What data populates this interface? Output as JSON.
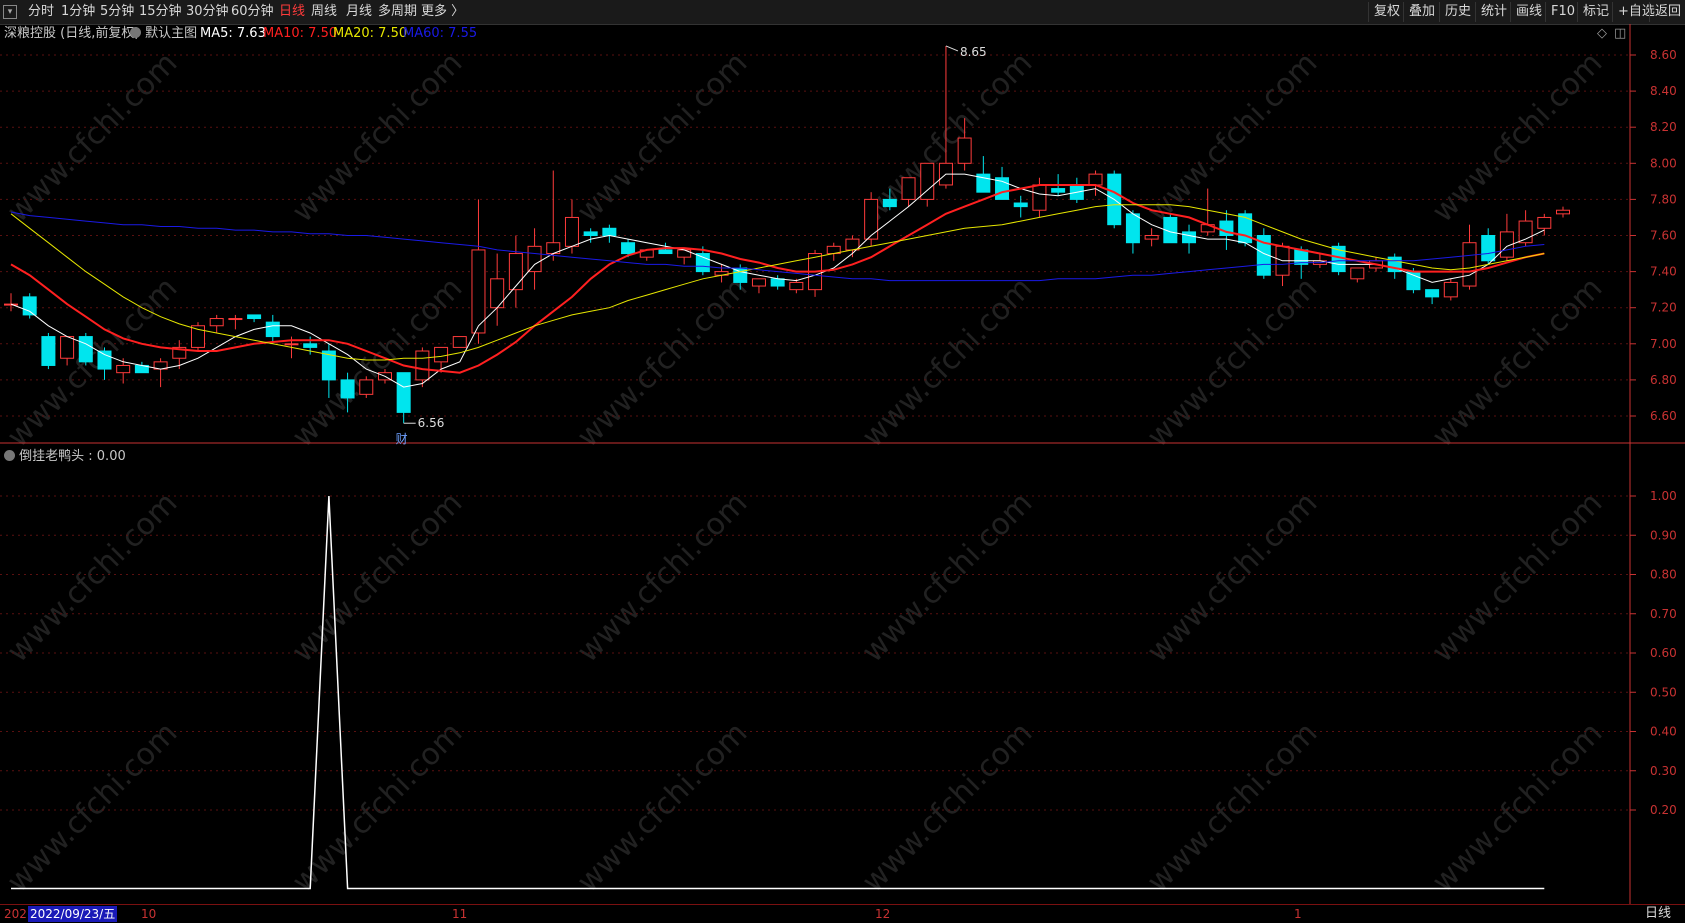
{
  "toolbar": {
    "periods": [
      "分时",
      "1分钟",
      "5分钟",
      "15分钟",
      "30分钟",
      "60分钟",
      "日线",
      "周线",
      "月线",
      "多周期",
      "更多 〉"
    ],
    "active_period": "日线",
    "right_buttons": [
      "复权",
      "叠加",
      "历史",
      "统计",
      "画线",
      "F10",
      "标记",
      "+自选",
      "返回"
    ]
  },
  "main_info": {
    "stock": "深粮控股 (日线,前复权)",
    "template": "默认主图",
    "ma5": "MA5: 7.63",
    "ma10": "MA10: 7.50",
    "ma20": "MA20: 7.50",
    "ma60": "MA60: 7.55"
  },
  "indicator_info": {
    "label": "倒挂老鸭头 : 0.00"
  },
  "annotations": {
    "high": "8.65",
    "low": "6.56",
    "marker": "财"
  },
  "bottom": {
    "prefix": "202",
    "date": "2022/09/23/五",
    "months": [
      "10",
      "11",
      "12",
      "1"
    ],
    "period": "日线"
  },
  "watermark": "www.cfchi.com",
  "colors": {
    "up": "#ff3b3b",
    "down": "#00e5ee",
    "ma5": "#ffffff",
    "ma10": "#ff2020",
    "ma20": "#e6e600",
    "ma60": "#1a1ae6",
    "axis": "#c83232",
    "indicator": "#ffffff"
  },
  "chart_data": [
    {
      "type": "candlestick",
      "title": "深粮控股 (日线,前复权)",
      "y_ticks": [
        "8.60",
        "8.40",
        "8.20",
        "8.00",
        "7.80",
        "7.60",
        "7.40",
        "7.20",
        "7.00",
        "6.80",
        "6.60"
      ],
      "ylim": [
        6.52,
        8.72
      ],
      "ohlc": [
        [
          7.22,
          7.28,
          7.18,
          7.22
        ],
        [
          7.26,
          7.28,
          7.14,
          7.16
        ],
        [
          7.04,
          7.06,
          6.86,
          6.88
        ],
        [
          6.92,
          7.04,
          6.88,
          7.04
        ],
        [
          7.04,
          7.06,
          6.88,
          6.9
        ],
        [
          6.96,
          6.98,
          6.8,
          6.86
        ],
        [
          6.84,
          6.92,
          6.78,
          6.88
        ],
        [
          6.88,
          6.9,
          6.84,
          6.84
        ],
        [
          6.86,
          6.92,
          6.76,
          6.9
        ],
        [
          6.92,
          7.02,
          6.86,
          6.98
        ],
        [
          6.98,
          7.12,
          6.96,
          7.1
        ],
        [
          7.1,
          7.16,
          7.06,
          7.14
        ],
        [
          7.14,
          7.16,
          7.08,
          7.14
        ],
        [
          7.16,
          7.16,
          7.12,
          7.14
        ],
        [
          7.12,
          7.16,
          7.0,
          7.04
        ],
        [
          7.0,
          7.04,
          6.92,
          7.0
        ],
        [
          7.0,
          7.04,
          6.94,
          6.98
        ],
        [
          6.96,
          7.0,
          6.7,
          6.8
        ],
        [
          6.8,
          6.84,
          6.62,
          6.7
        ],
        [
          6.72,
          6.82,
          6.7,
          6.8
        ],
        [
          6.8,
          6.86,
          6.78,
          6.84
        ],
        [
          6.84,
          6.84,
          6.56,
          6.62
        ],
        [
          6.8,
          6.98,
          6.76,
          6.96
        ],
        [
          6.9,
          6.98,
          6.84,
          6.98
        ],
        [
          6.98,
          7.04,
          6.98,
          7.04
        ],
        [
          7.06,
          7.8,
          7.0,
          7.52
        ],
        [
          7.2,
          7.5,
          7.1,
          7.36
        ],
        [
          7.3,
          7.6,
          7.2,
          7.5
        ],
        [
          7.4,
          7.64,
          7.3,
          7.54
        ],
        [
          7.5,
          7.96,
          7.46,
          7.56
        ],
        [
          7.54,
          7.8,
          7.5,
          7.7
        ],
        [
          7.62,
          7.64,
          7.56,
          7.6
        ],
        [
          7.64,
          7.66,
          7.56,
          7.6
        ],
        [
          7.56,
          7.58,
          7.48,
          7.5
        ],
        [
          7.48,
          7.52,
          7.46,
          7.52
        ],
        [
          7.52,
          7.56,
          7.5,
          7.5
        ],
        [
          7.48,
          7.52,
          7.44,
          7.52
        ],
        [
          7.5,
          7.54,
          7.38,
          7.4
        ],
        [
          7.38,
          7.44,
          7.34,
          7.4
        ],
        [
          7.42,
          7.44,
          7.3,
          7.34
        ],
        [
          7.32,
          7.36,
          7.28,
          7.36
        ],
        [
          7.36,
          7.38,
          7.3,
          7.32
        ],
        [
          7.3,
          7.36,
          7.28,
          7.34
        ],
        [
          7.3,
          7.52,
          7.26,
          7.5
        ],
        [
          7.5,
          7.56,
          7.46,
          7.54
        ],
        [
          7.52,
          7.6,
          7.48,
          7.58
        ],
        [
          7.58,
          7.84,
          7.54,
          7.8
        ],
        [
          7.8,
          7.86,
          7.74,
          7.76
        ],
        [
          7.8,
          7.92,
          7.76,
          7.92
        ],
        [
          7.8,
          8.0,
          7.76,
          8.0
        ],
        [
          7.88,
          8.65,
          7.86,
          8.0
        ],
        [
          8.0,
          8.25,
          7.96,
          8.14
        ],
        [
          7.94,
          8.04,
          7.84,
          7.84
        ],
        [
          7.92,
          7.98,
          7.8,
          7.8
        ],
        [
          7.78,
          7.82,
          7.7,
          7.76
        ],
        [
          7.74,
          7.92,
          7.7,
          7.88
        ],
        [
          7.86,
          7.94,
          7.82,
          7.84
        ],
        [
          7.88,
          7.92,
          7.78,
          7.8
        ],
        [
          7.88,
          7.96,
          7.82,
          7.94
        ],
        [
          7.94,
          7.96,
          7.64,
          7.66
        ],
        [
          7.72,
          7.74,
          7.5,
          7.56
        ],
        [
          7.58,
          7.64,
          7.54,
          7.6
        ],
        [
          7.7,
          7.72,
          7.56,
          7.56
        ],
        [
          7.62,
          7.66,
          7.5,
          7.56
        ],
        [
          7.62,
          7.86,
          7.6,
          7.66
        ],
        [
          7.68,
          7.74,
          7.52,
          7.6
        ],
        [
          7.72,
          7.74,
          7.54,
          7.56
        ],
        [
          7.6,
          7.64,
          7.36,
          7.38
        ],
        [
          7.38,
          7.56,
          7.32,
          7.54
        ],
        [
          7.52,
          7.54,
          7.36,
          7.44
        ],
        [
          7.44,
          7.5,
          7.42,
          7.46
        ],
        [
          7.54,
          7.56,
          7.38,
          7.4
        ],
        [
          7.36,
          7.42,
          7.34,
          7.42
        ],
        [
          7.42,
          7.48,
          7.4,
          7.46
        ],
        [
          7.48,
          7.5,
          7.36,
          7.4
        ],
        [
          7.4,
          7.42,
          7.28,
          7.3
        ],
        [
          7.3,
          7.3,
          7.22,
          7.26
        ],
        [
          7.26,
          7.36,
          7.24,
          7.34
        ],
        [
          7.32,
          7.66,
          7.3,
          7.56
        ],
        [
          7.6,
          7.64,
          7.44,
          7.46
        ],
        [
          7.48,
          7.72,
          7.46,
          7.62
        ],
        [
          7.56,
          7.74,
          7.54,
          7.68
        ],
        [
          7.64,
          7.72,
          7.6,
          7.7
        ],
        [
          7.72,
          7.76,
          7.7,
          7.74
        ]
      ],
      "series": [
        {
          "name": "MA5",
          "values": [
            7.22,
            7.18,
            7.1,
            7.04,
            7.0,
            6.94,
            6.9,
            6.88,
            6.86,
            6.88,
            6.92,
            6.98,
            7.04,
            7.08,
            7.1,
            7.1,
            7.06,
            7.0,
            6.94,
            6.86,
            6.82,
            6.76,
            6.78,
            6.86,
            6.9,
            7.1,
            7.2,
            7.32,
            7.44,
            7.5,
            7.54,
            7.58,
            7.6,
            7.58,
            7.56,
            7.54,
            7.52,
            7.48,
            7.44,
            7.4,
            7.38,
            7.36,
            7.35,
            7.38,
            7.42,
            7.5,
            7.6,
            7.68,
            7.76,
            7.85,
            7.94,
            7.94,
            7.92,
            7.9,
            7.86,
            7.83,
            7.82,
            7.84,
            7.86,
            7.8,
            7.72,
            7.66,
            7.62,
            7.6,
            7.58,
            7.58,
            7.56,
            7.5,
            7.46,
            7.46,
            7.46,
            7.44,
            7.44,
            7.44,
            7.42,
            7.38,
            7.34,
            7.36,
            7.38,
            7.44,
            7.54,
            7.58,
            7.63
          ]
        },
        {
          "name": "MA10",
          "values": [
            7.44,
            7.38,
            7.3,
            7.22,
            7.15,
            7.08,
            7.03,
            7.0,
            6.98,
            6.97,
            6.96,
            6.96,
            6.98,
            7.0,
            7.01,
            7.02,
            7.02,
            7.02,
            7.0,
            6.96,
            6.92,
            6.88,
            6.86,
            6.85,
            6.84,
            6.88,
            6.94,
            7.01,
            7.1,
            7.18,
            7.26,
            7.36,
            7.44,
            7.49,
            7.52,
            7.53,
            7.53,
            7.52,
            7.5,
            7.47,
            7.45,
            7.42,
            7.4,
            7.4,
            7.41,
            7.44,
            7.48,
            7.54,
            7.6,
            7.66,
            7.72,
            7.76,
            7.8,
            7.84,
            7.86,
            7.88,
            7.88,
            7.88,
            7.88,
            7.84,
            7.78,
            7.74,
            7.72,
            7.7,
            7.66,
            7.62,
            7.6,
            7.56,
            7.54,
            7.52,
            7.5,
            7.48,
            7.46,
            7.44,
            7.42,
            7.4,
            7.4,
            7.4,
            7.4,
            7.42,
            7.45,
            7.48,
            7.5
          ]
        },
        {
          "name": "MA20",
          "values": [
            7.72,
            7.64,
            7.56,
            7.48,
            7.4,
            7.33,
            7.26,
            7.2,
            7.15,
            7.11,
            7.08,
            7.06,
            7.04,
            7.02,
            7.0,
            6.98,
            6.96,
            6.94,
            6.92,
            6.91,
            6.91,
            6.92,
            6.92,
            6.93,
            6.95,
            6.98,
            7.02,
            7.06,
            7.1,
            7.13,
            7.16,
            7.18,
            7.2,
            7.24,
            7.27,
            7.3,
            7.33,
            7.36,
            7.38,
            7.4,
            7.42,
            7.44,
            7.46,
            7.48,
            7.5,
            7.52,
            7.54,
            7.56,
            7.58,
            7.6,
            7.62,
            7.64,
            7.65,
            7.66,
            7.68,
            7.7,
            7.72,
            7.74,
            7.76,
            7.77,
            7.77,
            7.77,
            7.77,
            7.76,
            7.74,
            7.72,
            7.7,
            7.66,
            7.62,
            7.58,
            7.55,
            7.52,
            7.5,
            7.48,
            7.46,
            7.44,
            7.42,
            7.41,
            7.42,
            7.44,
            7.46,
            7.48,
            7.5
          ]
        },
        {
          "name": "MA60",
          "values": [
            7.73,
            7.71,
            7.7,
            7.69,
            7.68,
            7.67,
            7.66,
            7.66,
            7.65,
            7.65,
            7.64,
            7.64,
            7.63,
            7.63,
            7.62,
            7.62,
            7.61,
            7.61,
            7.6,
            7.6,
            7.59,
            7.58,
            7.57,
            7.56,
            7.55,
            7.54,
            7.52,
            7.51,
            7.5,
            7.49,
            7.48,
            7.47,
            7.46,
            7.45,
            7.44,
            7.44,
            7.43,
            7.43,
            7.42,
            7.42,
            7.41,
            7.4,
            7.39,
            7.38,
            7.37,
            7.36,
            7.36,
            7.35,
            7.35,
            7.35,
            7.35,
            7.35,
            7.35,
            7.35,
            7.35,
            7.35,
            7.36,
            7.36,
            7.36,
            7.37,
            7.38,
            7.38,
            7.39,
            7.4,
            7.41,
            7.42,
            7.43,
            7.44,
            7.44,
            7.45,
            7.45,
            7.46,
            7.46,
            7.46,
            7.46,
            7.46,
            7.47,
            7.48,
            7.49,
            7.5,
            7.52,
            7.54,
            7.55
          ]
        }
      ]
    },
    {
      "type": "line",
      "title": "倒挂老鸭头",
      "y_ticks": [
        "1.00",
        "0.90",
        "0.80",
        "0.70",
        "0.60",
        "0.50",
        "0.40",
        "0.30",
        "0.20"
      ],
      "ylim": [
        0,
        1
      ],
      "series": [
        {
          "name": "倒挂老鸭头",
          "values": [
            0,
            0,
            0,
            0,
            0,
            0,
            0,
            0,
            0,
            0,
            0,
            0,
            0,
            0,
            0,
            0,
            0,
            1,
            0,
            0,
            0,
            0,
            0,
            0,
            0,
            0,
            0,
            0,
            0,
            0,
            0,
            0,
            0,
            0,
            0,
            0,
            0,
            0,
            0,
            0,
            0,
            0,
            0,
            0,
            0,
            0,
            0,
            0,
            0,
            0,
            0,
            0,
            0,
            0,
            0,
            0,
            0,
            0,
            0,
            0,
            0,
            0,
            0,
            0,
            0,
            0,
            0,
            0,
            0,
            0,
            0,
            0,
            0,
            0,
            0,
            0,
            0,
            0,
            0,
            0,
            0,
            0,
            0
          ]
        }
      ]
    }
  ]
}
